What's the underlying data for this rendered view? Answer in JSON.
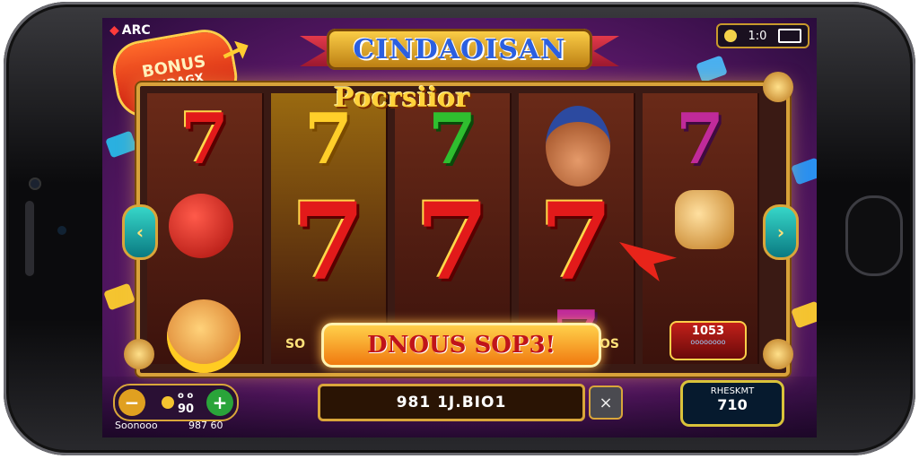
{
  "app": {
    "logo_text": "ARC",
    "clock_text": "1:0"
  },
  "banner": {
    "title": "CINDAOISAN"
  },
  "bonus_badge": {
    "line1": "BONUS",
    "line2": "ENDAGX"
  },
  "reels": {
    "overlay_text": "Pocrsiior",
    "symbols": [
      [
        "7",
        "face",
        "face"
      ],
      [
        "7",
        "7",
        "SO"
      ],
      [
        "7",
        "7",
        "7"
      ],
      [
        "face",
        "7",
        "7"
      ],
      [
        "7",
        "lock",
        "gem"
      ]
    ]
  },
  "bonus_bar": {
    "label": "DNOUS SOP3!",
    "left_tail": "SO",
    "right_tail": "OS"
  },
  "win_box": {
    "value": "1053",
    "label": "oooooooo"
  },
  "bottom": {
    "bet_small": "o o",
    "bet_value": "90",
    "bet_sub_left": "Soonooo",
    "bet_sub_right": "987 60",
    "spin_label": "981 1J.BIO1",
    "close_icon": "×",
    "credit_label": "RHESKMT",
    "credit_value": "710"
  },
  "colors": {
    "frame": "#d8a23a",
    "bg_magenta": "#b0336e",
    "seven_red": "#e21a1a",
    "credit_bg": "#061a2e"
  }
}
